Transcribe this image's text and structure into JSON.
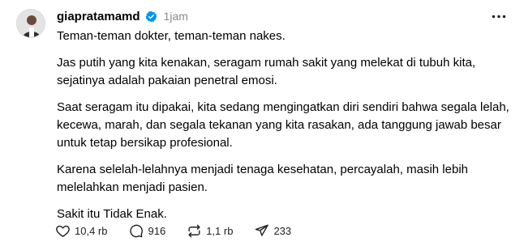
{
  "post": {
    "username": "giapratamamd",
    "timestamp": "1jam",
    "paragraphs": [
      "Teman-teman dokter, teman-teman nakes.",
      "Jas putih yang kita kenakan, seragam rumah sakit yang melekat di tubuh kita, sejatinya adalah pakaian penetral emosi.",
      "Saat seragam itu dipakai, kita sedang mengingatkan diri sendiri bahwa segala lelah, kecewa, marah, dan segala tekanan yang kita rasakan, ada tanggung jawab besar untuk tetap bersikap profesional.",
      "Karena selelah-lelahnya menjadi tenaga kesehatan, percayalah, masih lebih melelahkan menjadi pasien.",
      "Sakit itu Tidak Enak."
    ]
  },
  "actions": {
    "likes": "10,4 rb",
    "replies": "916",
    "reposts": "1,1 rb",
    "shares": "233"
  },
  "icons": {
    "verified": "verified-badge-icon",
    "more": "more-options-icon",
    "like": "heart-icon",
    "reply": "comment-bubble-icon",
    "repost": "repost-icon",
    "share": "send-icon"
  },
  "colors": {
    "verified": "#0095f6",
    "muted": "#8a8a8a"
  }
}
